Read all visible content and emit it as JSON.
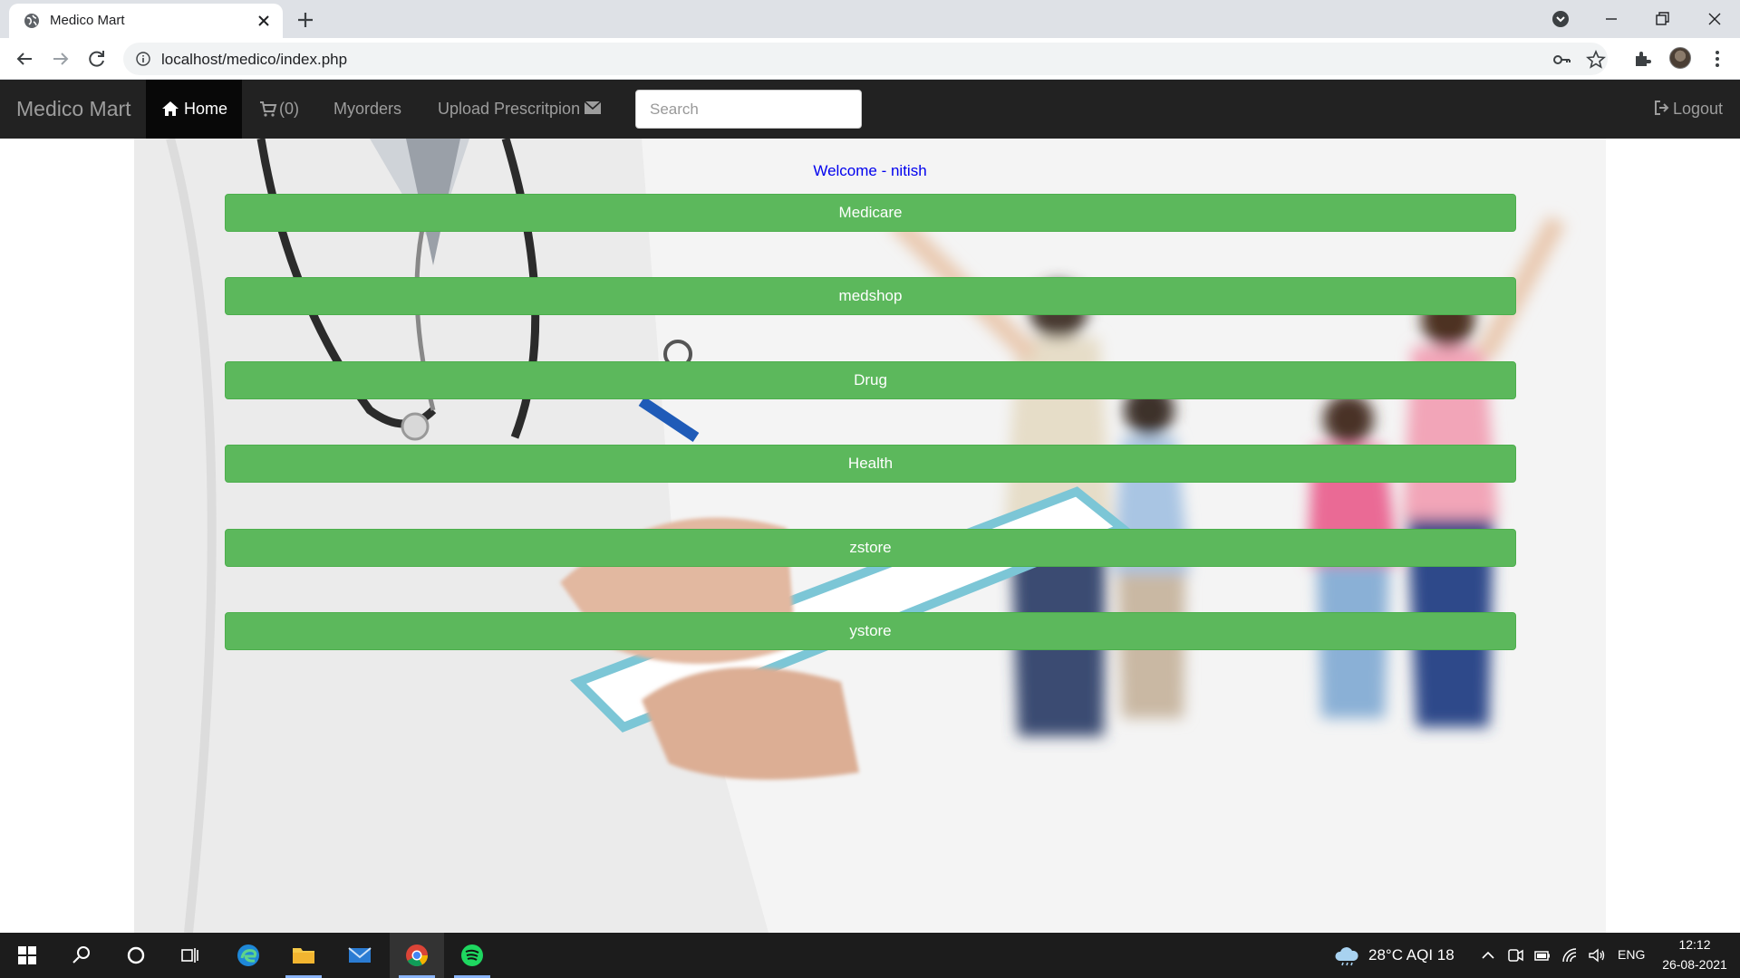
{
  "browser": {
    "tab_title": "Medico Mart",
    "url": "localhost/medico/index.php"
  },
  "navbar": {
    "brand": "Medico Mart",
    "home": "Home",
    "cart": "(0)",
    "myorders": "Myorders",
    "upload": "Upload Prescritpion",
    "search_placeholder": "Search",
    "logout": "Logout"
  },
  "main": {
    "welcome": "Welcome - nitish",
    "stores": [
      "Medicare",
      "medshop",
      "Drug",
      "Health",
      "zstore",
      "ystore"
    ]
  },
  "taskbar": {
    "weather": "28°C  AQI 18",
    "language": "ENG",
    "time": "12:12",
    "date": "26-08-2021"
  },
  "colors": {
    "navbar_bg": "#222222",
    "store_button": "#5cb85c",
    "welcome_link": "#0000ee"
  }
}
